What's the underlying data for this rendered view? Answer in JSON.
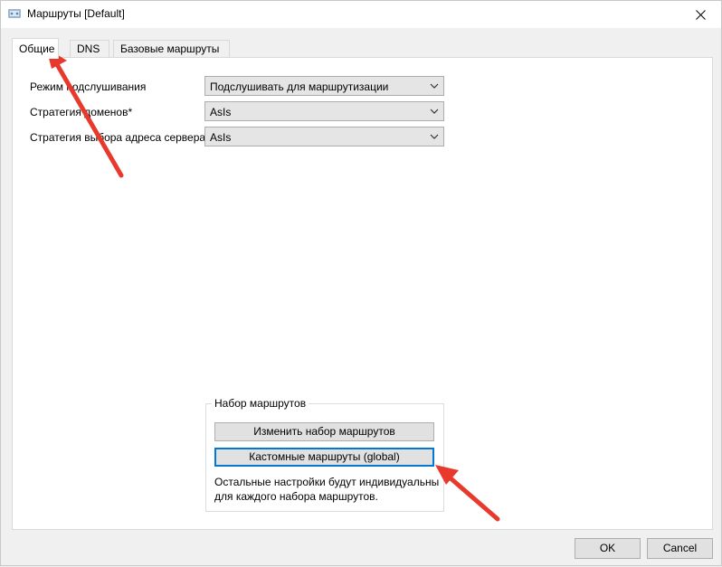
{
  "window": {
    "title": "Маршруты [Default]"
  },
  "tabs": [
    {
      "label": "Общие",
      "active": true
    },
    {
      "label": "DNS",
      "active": false
    },
    {
      "label": "Базовые маршруты",
      "active": false
    }
  ],
  "general": {
    "fields": [
      {
        "label": "Режим подслушивания",
        "value": "Подслушивать для маршрутизации"
      },
      {
        "label": "Стратегия доменов*",
        "value": "AsIs"
      },
      {
        "label": "Стратегия выбора адреса сервера",
        "value": "AsIs"
      }
    ]
  },
  "routeset": {
    "title": "Набор маршрутов",
    "change_button": "Изменить набор маршрутов",
    "custom_button": "Кастомные маршруты (global)",
    "note": "Остальные настройки будут индивидуальны для каждого набора маршрутов."
  },
  "footer": {
    "ok_label": "OK",
    "cancel_label": "Cancel"
  },
  "colors": {
    "annotation_arrow": "#e8392d",
    "focus_border": "#0078d7"
  },
  "icons": {
    "app": "app-icon",
    "close": "close-icon",
    "dropdown": "chevron-down-icon"
  }
}
